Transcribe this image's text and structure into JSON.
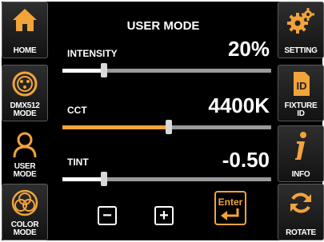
{
  "title": "USER MODE",
  "colors": {
    "accent": "#f2a43a",
    "track": "#9a9a9a",
    "fill_white": "#ffffff"
  },
  "left_menu": [
    {
      "label": "HOME",
      "icon": "home-icon",
      "active": false
    },
    {
      "label": "DMX512\nMODE",
      "icon": "dmx-connector-icon",
      "active": false
    },
    {
      "label": "USER\nMODE",
      "icon": "user-icon",
      "active": true
    },
    {
      "label": "COLOR\nMODE",
      "icon": "color-circles-icon",
      "active": false
    }
  ],
  "right_menu": [
    {
      "label": "SETTING",
      "icon": "gear-icon"
    },
    {
      "label": "FIXTURE\nID",
      "icon": "id-card-icon"
    },
    {
      "label": "INFO",
      "icon": "info-icon"
    },
    {
      "label": "ROTATE",
      "icon": "rotate-icon"
    }
  ],
  "params": [
    {
      "label": "INTENSITY",
      "value": "20%",
      "level": 0.2,
      "fill_color": "#ffffff"
    },
    {
      "label": "CCT",
      "value": "4400K",
      "level": 0.51,
      "fill_color": "#f2a43a"
    },
    {
      "label": "TINT",
      "value": "-0.50",
      "level": 0.2,
      "fill_color": "#ffffff"
    }
  ],
  "controls": {
    "minus": "−",
    "plus": "+",
    "enter": "Enter"
  }
}
